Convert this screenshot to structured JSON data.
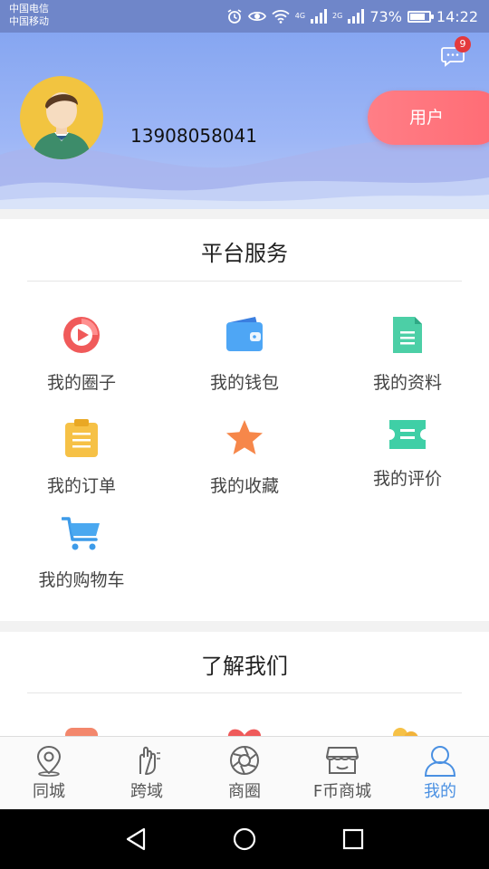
{
  "status_bar": {
    "carrier_1": "中国电信",
    "carrier_2": "中国移动",
    "network_1": "4G",
    "network_2": "2G",
    "battery": "73%",
    "battery_level": 0.73,
    "time": "14:22"
  },
  "header": {
    "message_badge": "9",
    "phone": "13908058041",
    "role_button": "用户"
  },
  "platform_services": {
    "title": "平台服务",
    "items": [
      {
        "label": "我的圈子",
        "icon": "circle-play-icon"
      },
      {
        "label": "我的钱包",
        "icon": "wallet-icon"
      },
      {
        "label": "我的资料",
        "icon": "document-icon"
      },
      {
        "label": "我的订单",
        "icon": "clipboard-icon"
      },
      {
        "label": "我的收藏",
        "icon": "star-icon"
      },
      {
        "label": "我的评价",
        "icon": "ticket-icon"
      },
      {
        "label": "我的购物车",
        "icon": "cart-icon"
      }
    ]
  },
  "about_us": {
    "title": "了解我们"
  },
  "tabbar": {
    "items": [
      {
        "label": "同城",
        "icon": "location-pin-icon"
      },
      {
        "label": "跨域",
        "icon": "hand-icon"
      },
      {
        "label": "商圈",
        "icon": "aperture-icon"
      },
      {
        "label": "F币商城",
        "icon": "store-icon"
      },
      {
        "label": "我的",
        "icon": "user-icon",
        "active": true
      }
    ],
    "active_color": "#4a90e2"
  },
  "colors": {
    "header_blue": "#86a6f1",
    "user_button": "#ff6b74",
    "badge_red": "#e4393c"
  }
}
